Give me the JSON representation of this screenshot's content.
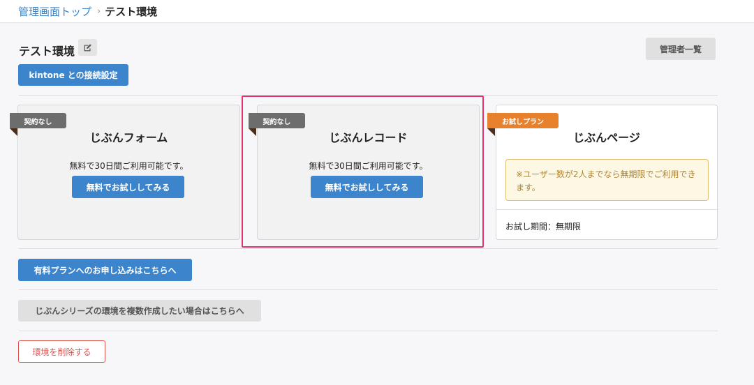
{
  "breadcrumb": {
    "link": "管理画面トップ",
    "separator": "›",
    "current": "テスト環境"
  },
  "page": {
    "title": "テスト環境",
    "edit_icon": "pencil-square-icon"
  },
  "buttons": {
    "admin_list": "管理者一覧",
    "kintone_settings": "kintone との接続設定",
    "paid_plan": "有料プランへのお申し込みはこちらへ",
    "multiple_env": "じぶんシリーズの環境を複数作成したい場合はこちらへ",
    "delete_env": "環境を削除する"
  },
  "cards": [
    {
      "badge": "契約なし",
      "title": "じぶんフォーム",
      "description": "無料で30日間ご利用可能です。",
      "button": "無料でお試ししてみる"
    },
    {
      "badge": "契約なし",
      "title": "じぶんレコード",
      "description": "無料で30日間ご利用可能です。",
      "button": "無料でお試ししてみる"
    },
    {
      "badge": "お試しプラン",
      "title": "じぶんページ",
      "notice": "※ユーザー数が2人までなら無期限でご利用できます。",
      "trial_period": "お試し期間：無期限"
    }
  ],
  "colors": {
    "primary": "#3c85cd",
    "danger": "#d9534f",
    "badge_gray": "#6d6d6d",
    "badge_orange": "#e8812e",
    "highlight": "#e2336f",
    "notice_text": "#b08434"
  }
}
